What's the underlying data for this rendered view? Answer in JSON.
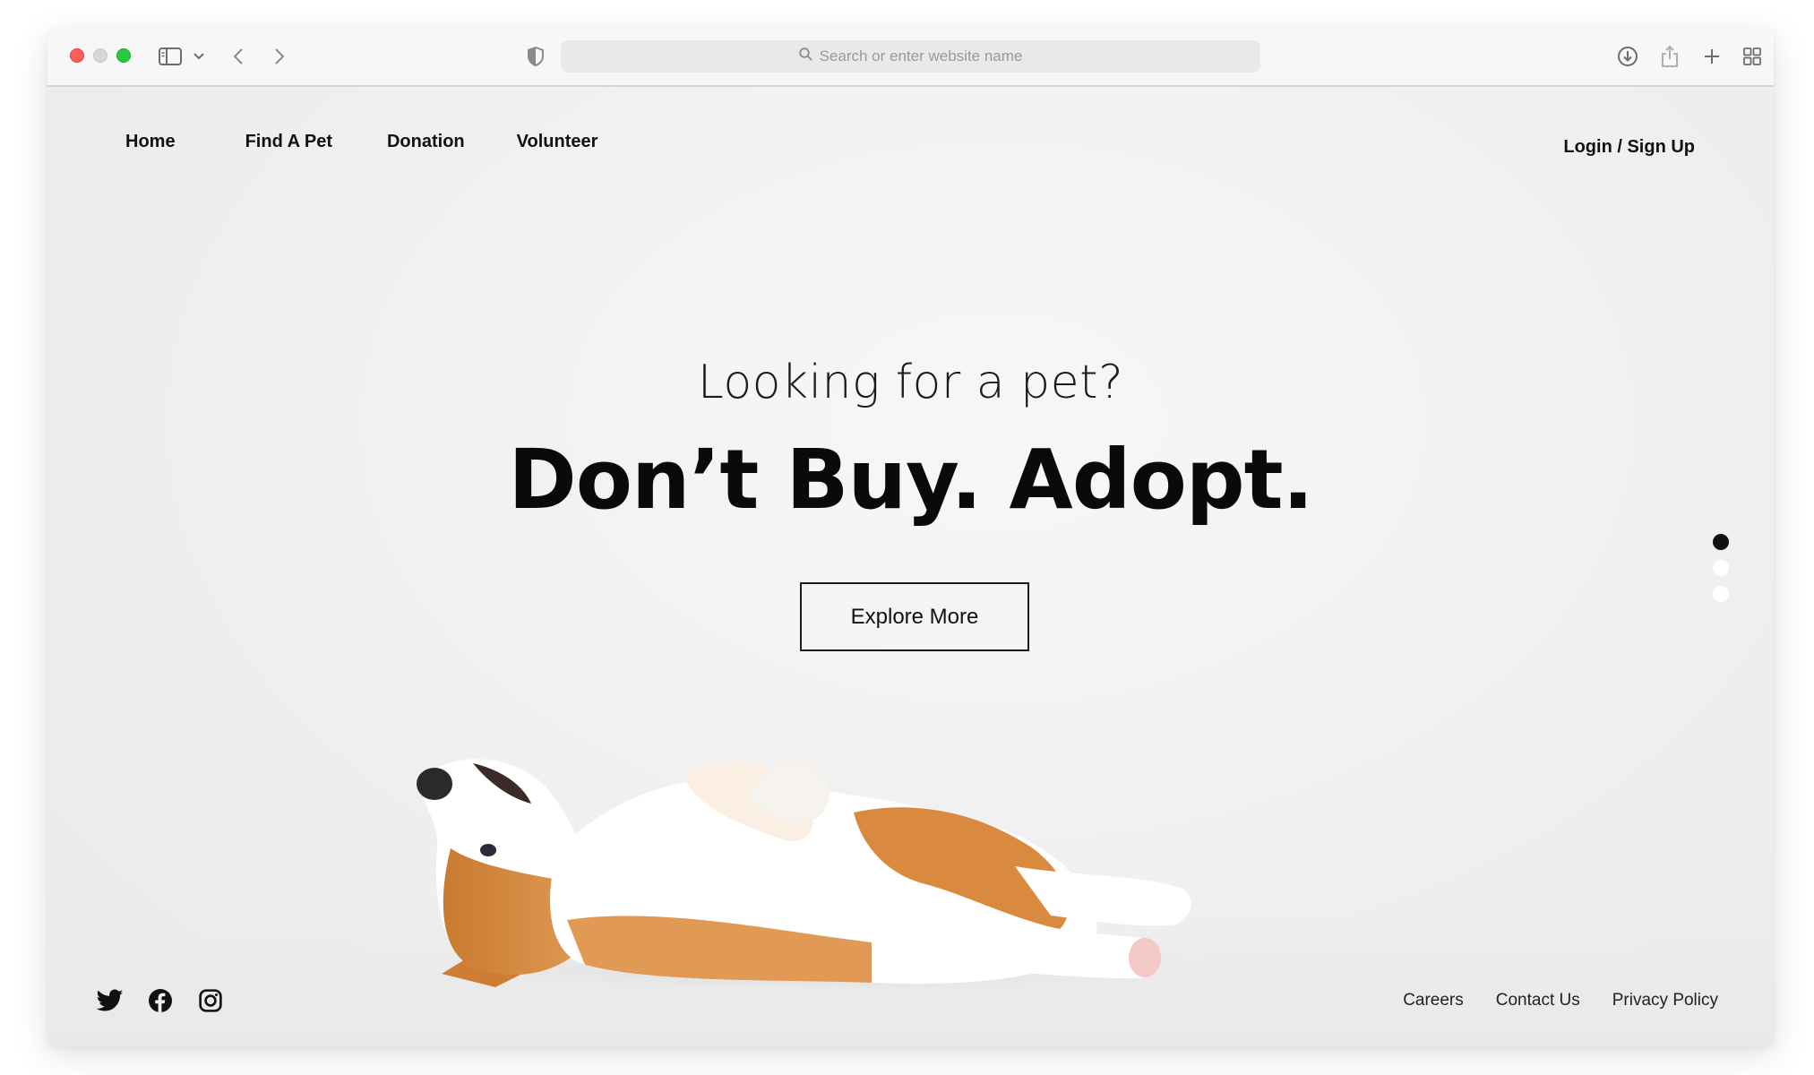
{
  "browser": {
    "address_placeholder": "Search or enter website name",
    "icons": [
      "sidebar-icon",
      "chevron-down-icon",
      "back-icon",
      "forward-icon",
      "shield-icon",
      "search-icon",
      "download-icon",
      "share-icon",
      "new-tab-icon",
      "tab-overview-icon"
    ]
  },
  "nav": {
    "items": [
      "Home",
      "Find A Pet",
      "Donation",
      "Volunteer"
    ],
    "login": "Login / Sign Up"
  },
  "hero": {
    "subtitle": "Looking for a pet?",
    "title": "Don’t Buy. Adopt.",
    "cta": "Explore More"
  },
  "carousel": {
    "slides": 3,
    "active": 1
  },
  "footer": {
    "socials": [
      "twitter-icon",
      "facebook-icon",
      "instagram-icon"
    ],
    "links": [
      "Careers",
      "Contact Us",
      "Privacy Policy"
    ]
  },
  "colors": {
    "accent": "#111111",
    "background": "#efefef",
    "dog_fur": "#d98a3e"
  }
}
